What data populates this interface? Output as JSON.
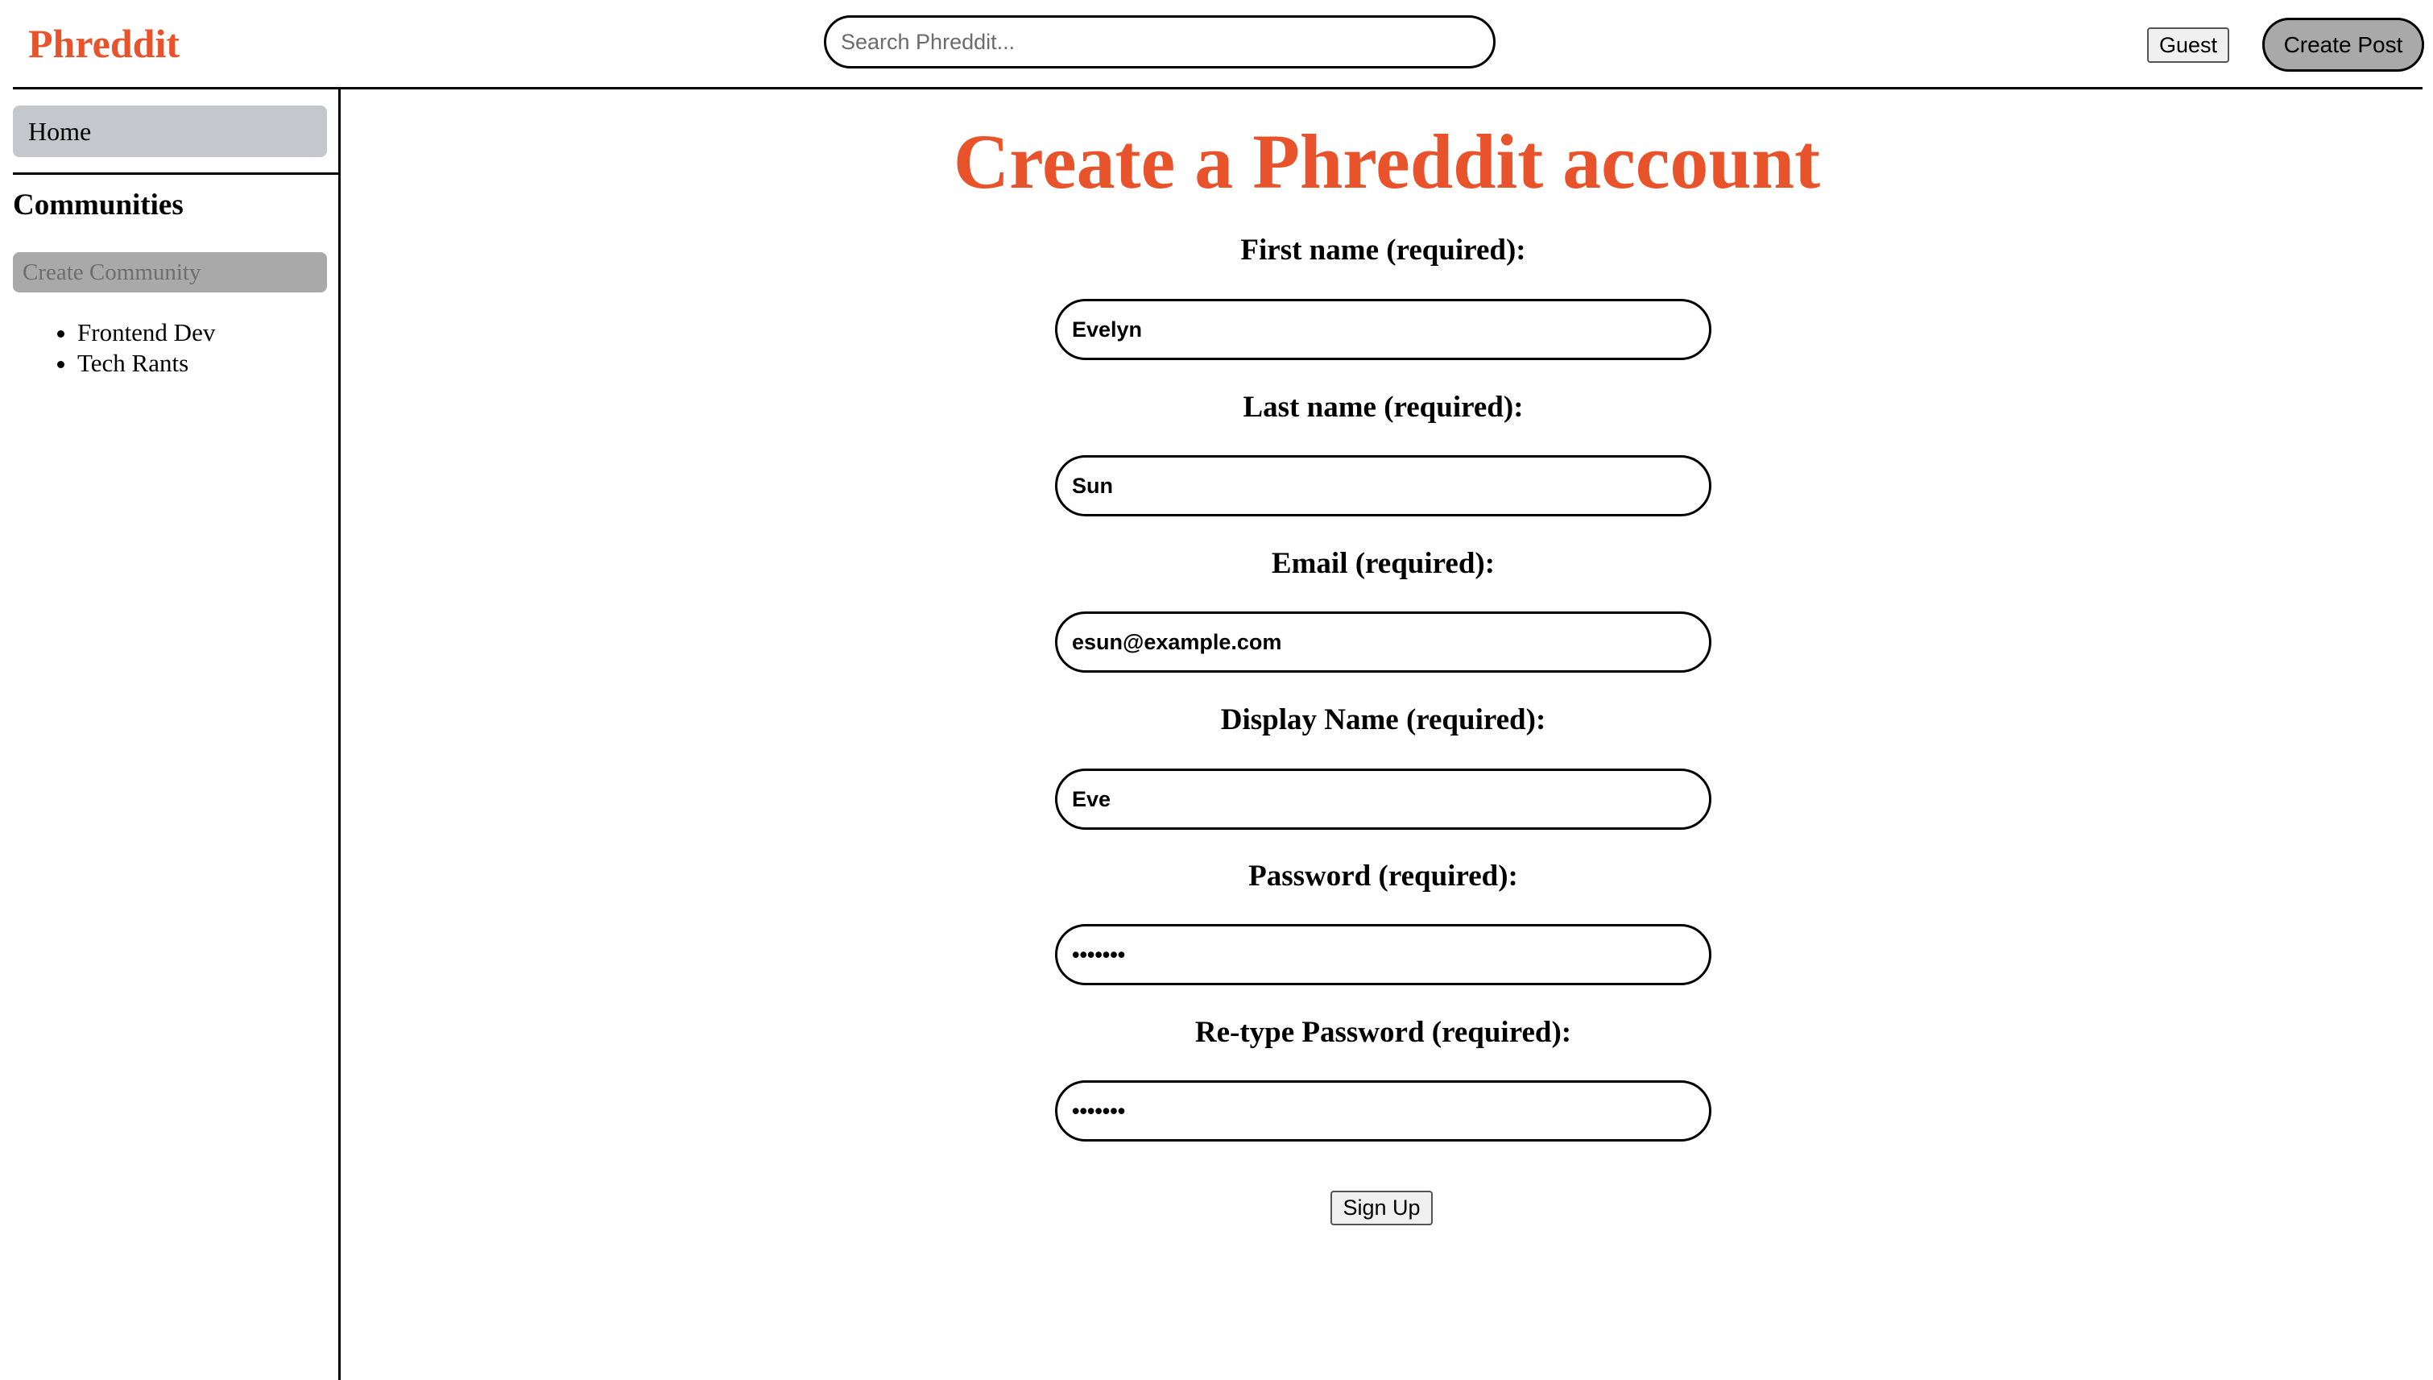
{
  "header": {
    "logo": "Phreddit",
    "search_placeholder": "Search Phreddit...",
    "guest_label": "Guest",
    "create_post_label": "Create Post"
  },
  "sidebar": {
    "home_label": "Home",
    "communities_heading": "Communities",
    "create_community_label": "Create Community",
    "communities": [
      "Frontend Dev",
      "Tech Rants"
    ]
  },
  "form": {
    "title": "Create a Phreddit account",
    "first_name_label": "First name (required):",
    "first_name_value": "Evelyn",
    "last_name_label": "Last name (required):",
    "last_name_value": "Sun",
    "email_label": "Email (required):",
    "email_value": "esun@example.com",
    "display_name_label": "Display Name (required):",
    "display_name_value": "Eve",
    "password_label": "Password (required):",
    "password_value": "1234567",
    "retype_password_label": "Re-type Password (required):",
    "retype_password_value": "1234567",
    "signup_label": "Sign Up"
  },
  "colors": {
    "brand": "#e8532b",
    "home_bg": "#c4c7cb",
    "button_gray": "#a9a9a9"
  }
}
